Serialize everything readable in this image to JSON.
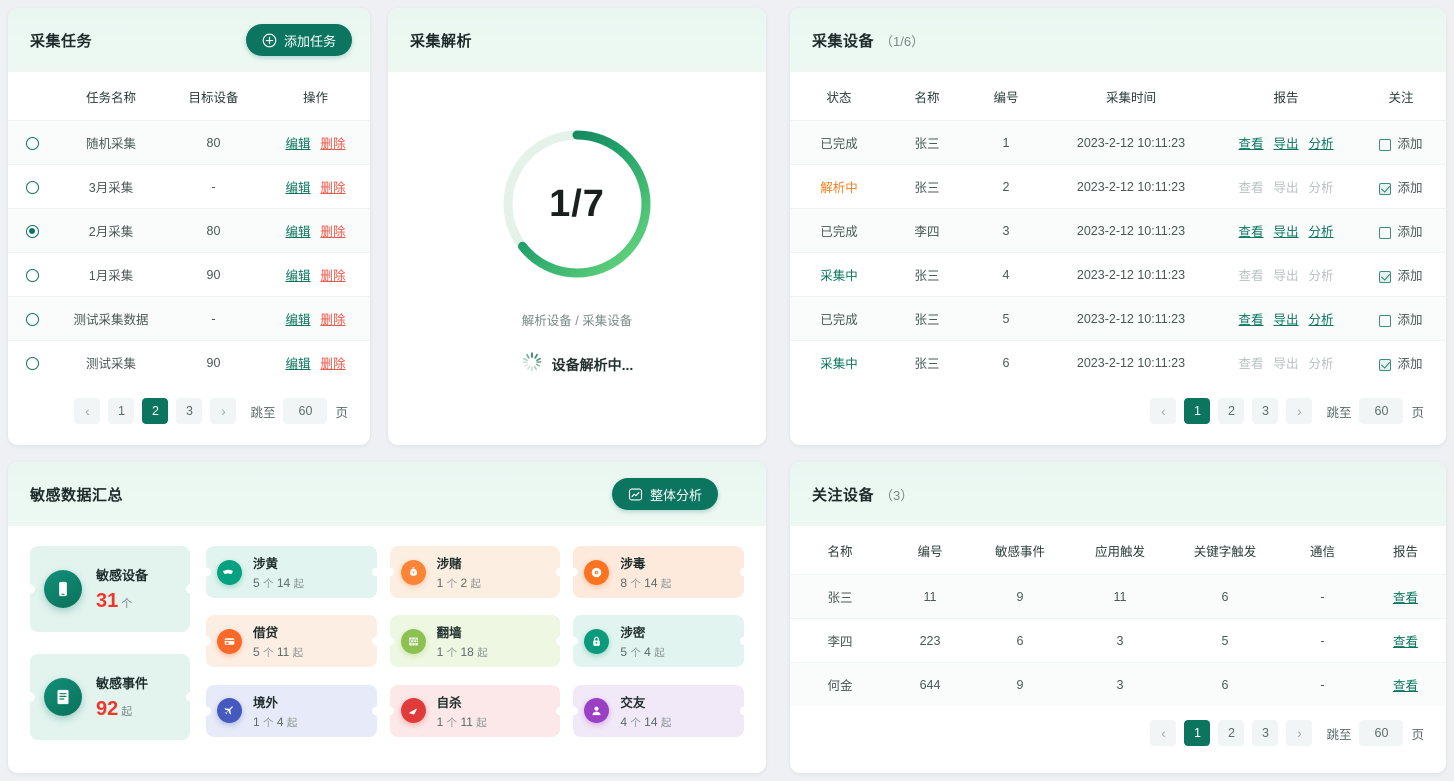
{
  "tasks_card": {
    "title": "采集任务",
    "add_button": {
      "label": "添加任务",
      "icon": "plus-circle-icon"
    },
    "columns": [
      "任务名称",
      "目标设备",
      "操作"
    ],
    "rows": [
      {
        "selected": false,
        "name": "随机采集",
        "target": "80",
        "edit": "编辑",
        "delete": "删除"
      },
      {
        "selected": false,
        "name": "3月采集",
        "target": "-",
        "edit": "编辑",
        "delete": "删除"
      },
      {
        "selected": true,
        "name": "2月采集",
        "target": "80",
        "edit": "编辑",
        "delete": "删除"
      },
      {
        "selected": false,
        "name": "1月采集",
        "target": "90",
        "edit": "编辑",
        "delete": "删除"
      },
      {
        "selected": false,
        "name": "测试采集数据",
        "target": "-",
        "edit": "编辑",
        "delete": "删除"
      },
      {
        "selected": false,
        "name": "测试采集",
        "target": "90",
        "edit": "编辑",
        "delete": "删除"
      }
    ],
    "pager": {
      "prev": "‹",
      "pages": [
        "1",
        "2",
        "3"
      ],
      "active": "2",
      "next": "›",
      "jump_label": "跳至",
      "jump_value": "60",
      "page_unit": "页"
    }
  },
  "parse_card": {
    "title": "采集解析",
    "value": "1/7",
    "caption": "解析设备 / 采集设备",
    "loading_text": "设备解析中...",
    "chart_data": {
      "type": "pie",
      "title": "采集解析",
      "categories": [
        "解析设备",
        "采集设备"
      ],
      "values": [
        1,
        7
      ],
      "display": "1/7",
      "arc_sweep_degrees": 232,
      "gradient_from": "#0d7053",
      "gradient_to": "#6ddc7f",
      "track_color": "#e4f2ea",
      "annotations": [
        "解析设备 / 采集设备",
        "设备解析中..."
      ]
    }
  },
  "devices_card": {
    "title": "采集设备",
    "count": "（1/6）",
    "columns": [
      "状态",
      "名称",
      "编号",
      "采集时间",
      "报告",
      "关注"
    ],
    "report_actions": [
      "查看",
      "导出",
      "分析"
    ],
    "watch_label": "添加",
    "rows": [
      {
        "status": "已完成",
        "status_kind": "done",
        "name": "张三",
        "no": "1",
        "time": "2023-2-12 10:11:23",
        "actions_enabled": true,
        "watched": false
      },
      {
        "status": "解析中",
        "status_kind": "parsing",
        "name": "张三",
        "no": "2",
        "time": "2023-2-12 10:11:23",
        "actions_enabled": false,
        "watched": true
      },
      {
        "status": "已完成",
        "status_kind": "done",
        "name": "李四",
        "no": "3",
        "time": "2023-2-12 10:11:23",
        "actions_enabled": true,
        "watched": false
      },
      {
        "status": "采集中",
        "status_kind": "collecting",
        "name": "张三",
        "no": "4",
        "time": "2023-2-12 10:11:23",
        "actions_enabled": false,
        "watched": true
      },
      {
        "status": "已完成",
        "status_kind": "done",
        "name": "张三",
        "no": "5",
        "time": "2023-2-12 10:11:23",
        "actions_enabled": true,
        "watched": false
      },
      {
        "status": "采集中",
        "status_kind": "collecting",
        "name": "张三",
        "no": "6",
        "time": "2023-2-12 10:11:23",
        "actions_enabled": false,
        "watched": true
      }
    ],
    "pager": {
      "prev": "‹",
      "pages": [
        "1",
        "2",
        "3"
      ],
      "active": "1",
      "next": "›",
      "jump_label": "跳至",
      "jump_value": "60",
      "page_unit": "页"
    }
  },
  "sensitive_card": {
    "title": "敏感数据汇总",
    "analysis_button": {
      "label": "整体分析",
      "icon": "chart-box-icon"
    },
    "highlights": [
      {
        "name": "敏感设备",
        "value": "31",
        "unit": "个",
        "icon": "phone-icon"
      },
      {
        "name": "敏感事件",
        "value": "92",
        "unit": "起",
        "icon": "document-icon"
      }
    ],
    "categories": [
      {
        "name": "涉黄",
        "count": "5",
        "count_unit": "个",
        "cases": "14",
        "case_unit": "起",
        "icon": "mask-icon",
        "icon_color": "#07a080",
        "bg": "#e2f4ef"
      },
      {
        "name": "涉赌",
        "count": "1",
        "count_unit": "个",
        "cases": "2",
        "case_unit": "起",
        "icon": "money-bag-icon",
        "icon_color": "#fb8436",
        "bg": "#fdeee2"
      },
      {
        "name": "涉毒",
        "count": "8",
        "count_unit": "个",
        "cases": "14",
        "case_unit": "起",
        "icon": "pill-icon",
        "icon_color": "#fc7321",
        "bg": "#fdeadd"
      },
      {
        "name": "借贷",
        "count": "5",
        "count_unit": "个",
        "cases": "11",
        "case_unit": "起",
        "icon": "card-icon",
        "icon_color": "#f96a2a",
        "bg": "#fdeee4"
      },
      {
        "name": "翻墙",
        "count": "1",
        "count_unit": "个",
        "cases": "18",
        "case_unit": "起",
        "icon": "wall-icon",
        "icon_color": "#8cc152",
        "bg": "#eef7e2"
      },
      {
        "name": "涉密",
        "count": "5",
        "count_unit": "个",
        "cases": "4",
        "case_unit": "起",
        "icon": "lock-icon",
        "icon_color": "#0b9a7b",
        "bg": "#e2f4ef"
      },
      {
        "name": "境外",
        "count": "1",
        "count_unit": "个",
        "cases": "4",
        "case_unit": "起",
        "icon": "plane-icon",
        "icon_color": "#4559bf",
        "bg": "#e7eaf8"
      },
      {
        "name": "自杀",
        "count": "1",
        "count_unit": "个",
        "cases": "11",
        "case_unit": "起",
        "icon": "blade-icon",
        "icon_color": "#e03a3a",
        "bg": "#fce8e8"
      },
      {
        "name": "交友",
        "count": "4",
        "count_unit": "个",
        "cases": "14",
        "case_unit": "起",
        "icon": "person-icon",
        "icon_color": "#9b3fc4",
        "bg": "#f1e8f8"
      }
    ]
  },
  "watch_card": {
    "title": "关注设备",
    "count": "（3）",
    "columns": [
      "名称",
      "编号",
      "敏感事件",
      "应用触发",
      "关键字触发",
      "通信",
      "报告"
    ],
    "rows": [
      {
        "name": "张三",
        "no": "11",
        "sensitive": "9",
        "app_trigger": "11",
        "keyword_trigger": "6",
        "comm": "-",
        "report": "查看"
      },
      {
        "name": "李四",
        "no": "223",
        "sensitive": "6",
        "app_trigger": "3",
        "keyword_trigger": "5",
        "comm": "-",
        "report": "查看"
      },
      {
        "name": "何金",
        "no": "644",
        "sensitive": "9",
        "app_trigger": "3",
        "keyword_trigger": "6",
        "comm": "-",
        "report": "查看"
      }
    ],
    "pager": {
      "prev": "‹",
      "pages": [
        "1",
        "2",
        "3"
      ],
      "active": "1",
      "next": "›",
      "jump_label": "跳至",
      "jump_value": "60",
      "page_unit": "页"
    }
  },
  "theme": {
    "primary": "#0b7560",
    "danger": "#f0362b",
    "delete": "#f0564a",
    "warning": "#f58020",
    "page_bg": "#eef0f3",
    "header_bg": "#eaf7f1"
  }
}
